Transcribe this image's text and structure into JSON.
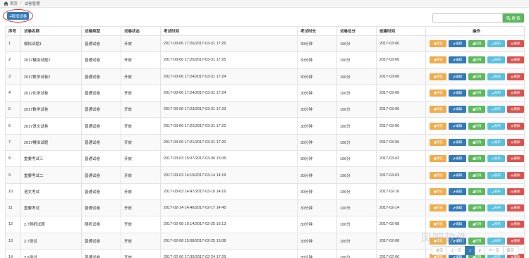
{
  "breadcrumb": {
    "home": "首页",
    "current": "试卷管理"
  },
  "toolbar": {
    "add_label": "+新增试卷",
    "search_placeholder": "",
    "search_label": "搜 索"
  },
  "table": {
    "headers": [
      "序号",
      "试卷名称",
      "试卷类型",
      "试卷状态",
      "考试时间",
      "考试时长",
      "试卷总分",
      "创建时间",
      "操作"
    ],
    "op_labels": {
      "preview": "预览",
      "edit": "编辑",
      "perm": "权限",
      "publish": "发布",
      "delete": "删除"
    },
    "rows": [
      {
        "no": "1",
        "name": "模拟试题1",
        "type": "普通试卷",
        "status": "开放",
        "time": "2017-03-06 17:26/2017-03-31 17:26",
        "duration": "30分钟",
        "score": "100分",
        "created": "2017-03-06"
      },
      {
        "no": "2",
        "name": "2017模拟试题2",
        "type": "普通试卷",
        "status": "开放",
        "time": "2017-03-06 17:25/2017-03-31 17:25",
        "duration": "30分钟",
        "score": "100分",
        "created": "2017-03-06"
      },
      {
        "no": "3",
        "name": "2017数学试卷2",
        "type": "普通试卷",
        "status": "开放",
        "time": "2017-03-06 17:24/2017-03-31 17:24",
        "duration": "30分钟",
        "score": "100分",
        "created": "2017-03-06"
      },
      {
        "no": "4",
        "name": "2017化学试卷",
        "type": "普通试卷",
        "status": "开放",
        "time": "2017-03-06 17:24/2017-03-31 17:24",
        "duration": "30分钟",
        "score": "100分",
        "created": "2017-03-06"
      },
      {
        "no": "5",
        "name": "2017数学试卷",
        "type": "普通试卷",
        "status": "开放",
        "time": "2017-03-06 17:23/2017-03-31 17:23",
        "duration": "30分钟",
        "score": "100分",
        "created": "2017-03-06"
      },
      {
        "no": "6",
        "name": "2017语文试卷",
        "type": "普通试卷",
        "status": "开放",
        "time": "2017-03-06 17:22/2017-03-31 17:22",
        "duration": "30分钟",
        "score": "100分",
        "created": "2017-03-06"
      },
      {
        "no": "7",
        "name": "2017模拟试题",
        "type": "普通试卷",
        "status": "开放",
        "time": "2017-03-06 17:21/2017-03-31 17:20",
        "duration": "30分钟",
        "score": "100分",
        "created": "2017-03-06"
      },
      {
        "no": "8",
        "name": "重要考试三",
        "type": "普通试卷",
        "status": "开放",
        "time": "2017-03-03 15:07/2017-03-30 15:06",
        "duration": "30分钟",
        "score": "100分",
        "created": "2017-03-03"
      },
      {
        "no": "9",
        "name": "重要考试二",
        "type": "普通试卷",
        "status": "开放",
        "time": "2017-03-03 14:19/2017-03-14 14:19",
        "duration": "30分钟",
        "score": "100分",
        "created": "2017-03-03"
      },
      {
        "no": "10",
        "name": "语文考试",
        "type": "普通试卷",
        "status": "开放",
        "time": "2017-03-03 14:47/2017-03-10 14:16",
        "duration": "30分钟",
        "score": "100分",
        "created": "2017-02-16"
      },
      {
        "no": "11",
        "name": "重要考试",
        "type": "普通试卷",
        "status": "开放",
        "time": "2017-02-14 14:46/2017-02-17 14:45",
        "duration": "30分钟",
        "score": "100分",
        "created": "2017-02-14"
      },
      {
        "no": "12",
        "name": "2.7随机试题",
        "type": "随机试卷",
        "status": "开放",
        "time": "2017-02-08 16:14/2017-02-25 16:13",
        "duration": "30分钟",
        "score": "100分",
        "created": "2017-02-08"
      },
      {
        "no": "13",
        "name": "2.7测试",
        "type": "普通试卷",
        "status": "开放",
        "time": "2017-02-08 15:08/2017-02-25 15:08",
        "duration": "30分钟",
        "score": "100分",
        "created": "2017-02-08"
      },
      {
        "no": "14",
        "name": "2.6测试",
        "type": "普通试卷",
        "status": "开放",
        "time": "2017-02-06 17:30/2017-02-24 17:29",
        "duration": "30分钟",
        "score": "100分",
        "created": "2017-02-06"
      }
    ]
  },
  "pagination": {
    "first": "首页",
    "prev": "上一页",
    "pages": [
      "1",
      "2"
    ],
    "current": "1",
    "next": "下一页",
    "last": "尾页"
  },
  "watermark": "风吧软件",
  "colors": {
    "primary": "#337ab7",
    "success": "#5cb85c",
    "warning": "#f0ad4e",
    "info": "#5bc0de",
    "danger": "#d9534f",
    "highlight_ring": "#d9342b"
  }
}
